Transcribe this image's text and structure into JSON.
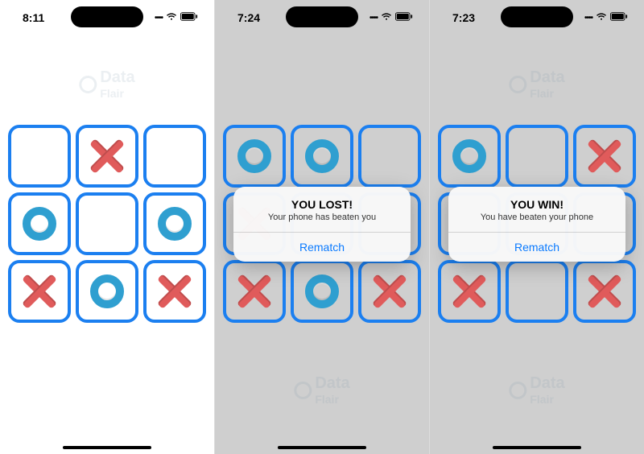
{
  "watermark": {
    "brand_top": "Data",
    "brand_bottom": "Flair"
  },
  "screens": [
    {
      "time": "8:11",
      "dimmed": false,
      "alert": null,
      "board": [
        [
          "",
          "X",
          ""
        ],
        [
          "O",
          "",
          "O"
        ],
        [
          "X",
          "O",
          "X"
        ]
      ],
      "watermarks": [
        "top"
      ]
    },
    {
      "time": "7:24",
      "dimmed": true,
      "alert": {
        "title": "YOU LOST!",
        "message": "Your phone has beaten you",
        "button": "Rematch"
      },
      "board": [
        [
          "O",
          "O",
          ""
        ],
        [
          "X",
          "",
          ""
        ],
        [
          "X",
          "O",
          "X"
        ]
      ],
      "watermarks": [
        "bottom"
      ]
    },
    {
      "time": "7:23",
      "dimmed": true,
      "alert": {
        "title": "YOU WIN!",
        "message": "You have beaten your phone",
        "button": "Rematch"
      },
      "board": [
        [
          "O",
          "",
          "X"
        ],
        [
          "",
          "",
          ""
        ],
        [
          "X",
          "",
          "X"
        ]
      ],
      "watermarks": [
        "top",
        "bottom"
      ]
    }
  ]
}
